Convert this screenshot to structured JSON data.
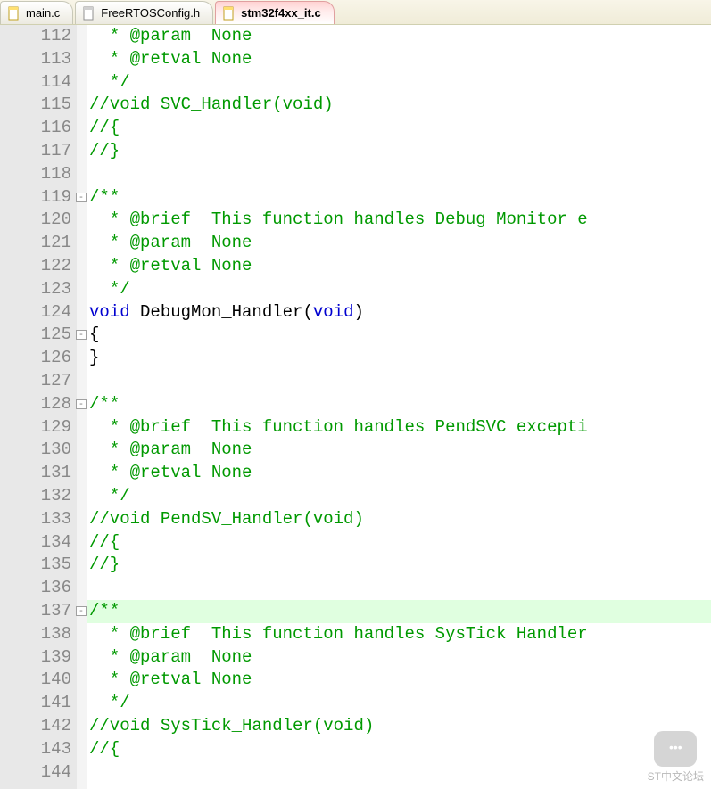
{
  "tabs": [
    {
      "label": "main.c",
      "active": false
    },
    {
      "label": "FreeRTOSConfig.h",
      "active": false
    },
    {
      "label": "stm32f4xx_it.c",
      "active": true
    }
  ],
  "startLine": 112,
  "endLine": 144,
  "highlightLine": 137,
  "foldMarks": [
    119,
    125,
    128,
    137
  ],
  "code": {
    "112": [
      [
        "  * @param  None",
        "c"
      ]
    ],
    "113": [
      [
        "  * @retval None",
        "c"
      ]
    ],
    "114": [
      [
        "  */",
        "c"
      ]
    ],
    "115": [
      [
        "//void SVC_Handler(void)",
        "c"
      ]
    ],
    "116": [
      [
        "//{",
        "c"
      ]
    ],
    "117": [
      [
        "//}",
        "c"
      ]
    ],
    "118": [
      [
        "",
        ""
      ]
    ],
    "119": [
      [
        "/**",
        "c"
      ]
    ],
    "120": [
      [
        "  * @brief  This function handles Debug Monitor e",
        "c"
      ]
    ],
    "121": [
      [
        "  * @param  None",
        "c"
      ]
    ],
    "122": [
      [
        "  * @retval None",
        "c"
      ]
    ],
    "123": [
      [
        "  */",
        "c"
      ]
    ],
    "124": [
      [
        "void",
        "k"
      ],
      [
        " ",
        ""
      ],
      [
        "DebugMon_Handler",
        "f"
      ],
      [
        "(",
        ""
      ],
      [
        "void",
        "k"
      ],
      [
        ")",
        ""
      ]
    ],
    "125": [
      [
        "{",
        ""
      ]
    ],
    "126": [
      [
        "}",
        ""
      ]
    ],
    "127": [
      [
        "",
        ""
      ]
    ],
    "128": [
      [
        "/**",
        "c"
      ]
    ],
    "129": [
      [
        "  * @brief  This function handles PendSVC excepti",
        "c"
      ]
    ],
    "130": [
      [
        "  * @param  None",
        "c"
      ]
    ],
    "131": [
      [
        "  * @retval None",
        "c"
      ]
    ],
    "132": [
      [
        "  */",
        "c"
      ]
    ],
    "133": [
      [
        "//void PendSV_Handler(void)",
        "c"
      ]
    ],
    "134": [
      [
        "//{",
        "c"
      ]
    ],
    "135": [
      [
        "//}",
        "c"
      ]
    ],
    "136": [
      [
        "",
        ""
      ]
    ],
    "137": [
      [
        "/**",
        "c"
      ]
    ],
    "138": [
      [
        "  * @brief  This function handles SysTick Handler",
        "c"
      ]
    ],
    "139": [
      [
        "  * @param  None",
        "c"
      ]
    ],
    "140": [
      [
        "  * @retval None",
        "c"
      ]
    ],
    "141": [
      [
        "  */",
        "c"
      ]
    ],
    "142": [
      [
        "//void SysTick_Handler(void)",
        "c"
      ]
    ],
    "143": [
      [
        "//{",
        "c"
      ]
    ],
    "144": [
      [
        "",
        ""
      ]
    ]
  },
  "watermark": "ST中文论坛"
}
